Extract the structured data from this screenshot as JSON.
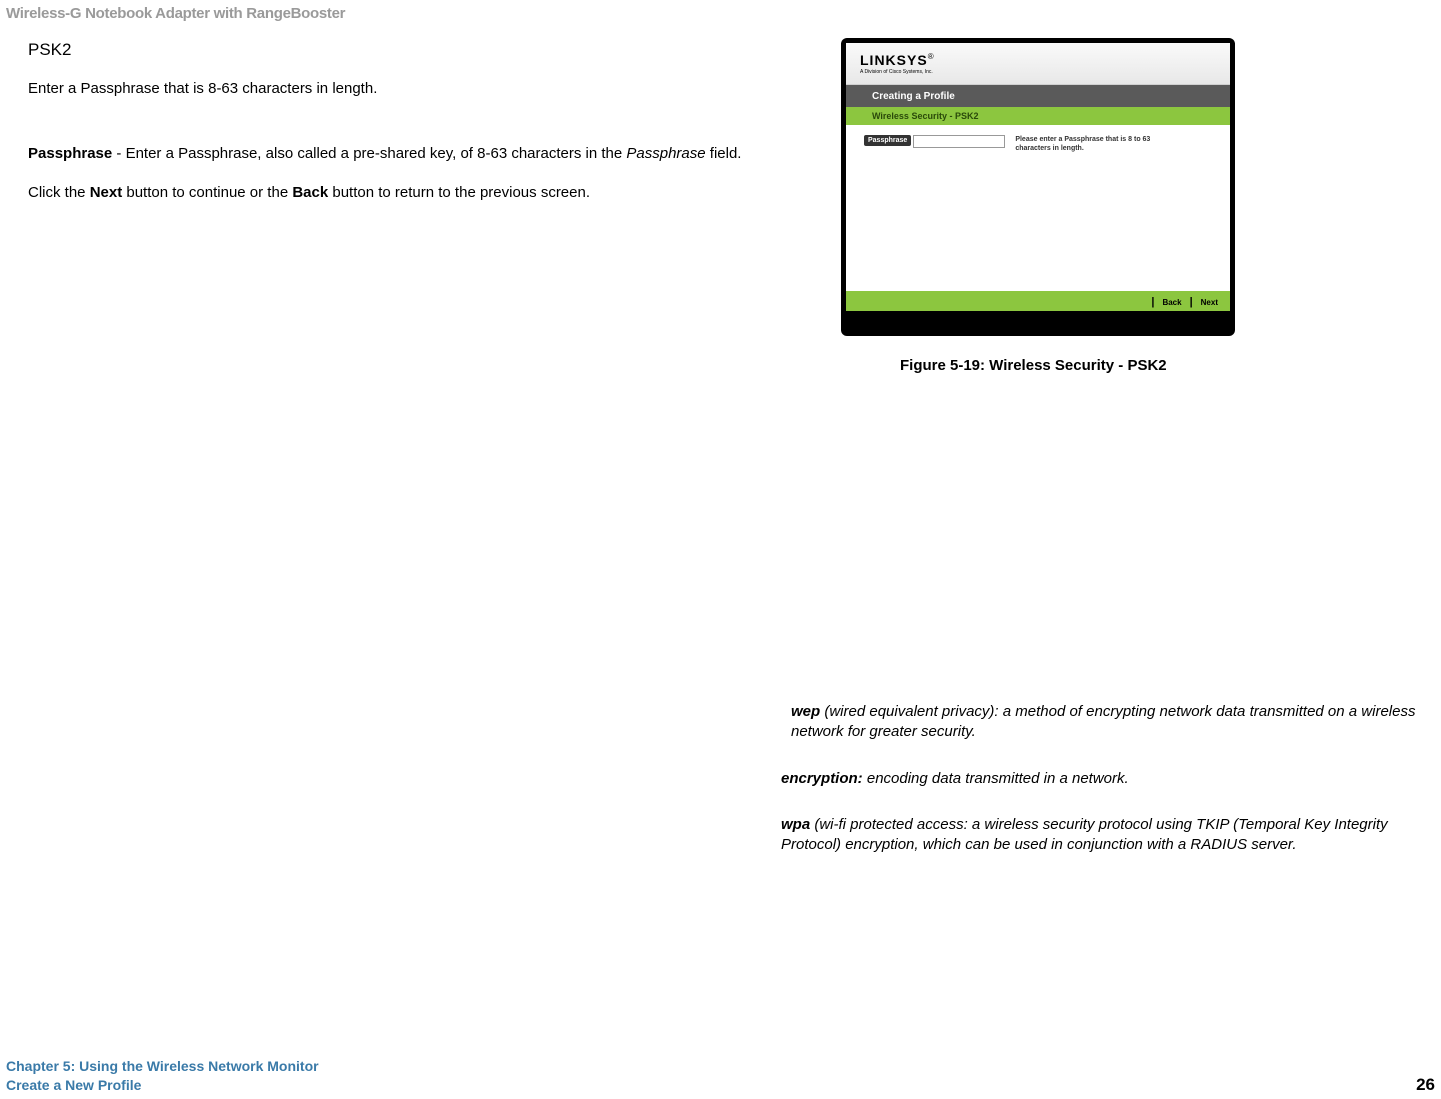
{
  "header": {
    "product_title": "Wireless-G Notebook Adapter with RangeBooster"
  },
  "content": {
    "section_title": "PSK2",
    "intro": "Enter a Passphrase that is 8-63 characters in length.",
    "passphrase_label": "Passphrase",
    "passphrase_text_1": " - Enter a Passphrase, also called a pre-shared key, of 8-63 characters in the ",
    "passphrase_field_name": "Passphrase",
    "passphrase_text_2": " field.",
    "click_prefix": "Click the ",
    "click_next": "Next",
    "click_mid": " button to continue or the ",
    "click_back": "Back",
    "click_suffix": " button to return to the previous screen."
  },
  "screenshot": {
    "logo_main": "LINKSYS",
    "logo_reg": "®",
    "logo_sub": "A Division of Cisco Systems, Inc.",
    "creating_label": "Creating a Profile",
    "security_label": "Wireless Security - PSK2",
    "form_label": "Passphrase",
    "form_help": "Please enter a Passphrase that is 8 to 63 characters in length.",
    "nav_back": "Back",
    "nav_next": "Next"
  },
  "figure_caption": "Figure 5-19: Wireless Security - PSK2",
  "definitions": {
    "wep_term": "wep",
    "wep_text": " (wired equivalent privacy): a method of encrypting network data transmitted on a wireless network for greater security.",
    "encryption_term": "encryption:",
    "encryption_text": " encoding data transmitted in a network.",
    "wpa_term": "wpa",
    "wpa_text": " (wi-fi protected access: a wireless security protocol using TKIP (Temporal Key Integrity Protocol) encryption, which can be used in conjunction with a RADIUS server."
  },
  "footer": {
    "chapter": "Chapter 5: Using the Wireless Network Monitor",
    "section": "Create a New Profile",
    "page_number": "26"
  }
}
